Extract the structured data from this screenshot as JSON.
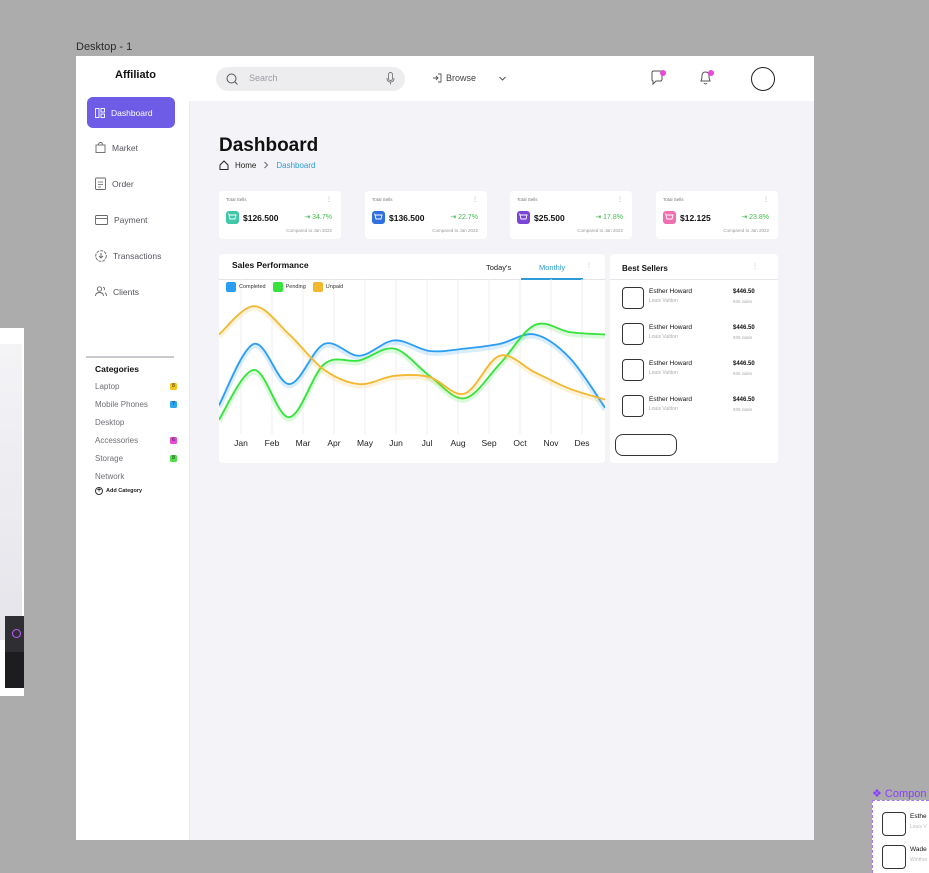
{
  "frame_label": "Desktop - 1",
  "app": {
    "name": "Affiliato"
  },
  "topbar": {
    "search_placeholder": "Search",
    "browse_label": "Browse"
  },
  "sidebar": {
    "items": [
      {
        "label": "Dashboard",
        "icon": "dashboard-icon",
        "active": true
      },
      {
        "label": "Market",
        "icon": "bag-icon"
      },
      {
        "label": "Order",
        "icon": "clipboard-icon"
      },
      {
        "label": "Payment",
        "icon": "card-icon"
      },
      {
        "label": "Transactions",
        "icon": "coin-icon"
      },
      {
        "label": "Clients",
        "icon": "users-icon"
      }
    ],
    "categories_title": "Categories",
    "categories": [
      {
        "label": "Laptop",
        "count": "8",
        "color": "#f5c518"
      },
      {
        "label": "Mobile Phones",
        "count": "7",
        "color": "#2aa7f0"
      },
      {
        "label": "Desktop",
        "count": "",
        "color": ""
      },
      {
        "label": "Accessories",
        "count": "6",
        "color": "#e64ad6"
      },
      {
        "label": "Storage",
        "count": "8",
        "color": "#52e04a"
      },
      {
        "label": "Network",
        "count": "",
        "color": ""
      }
    ],
    "add_category": "Add Category"
  },
  "page": {
    "title": "Dashboard",
    "breadcrumb_home": "Home",
    "breadcrumb_current": "Dashboard"
  },
  "stats": [
    {
      "label": "Total Sells",
      "value": "$126.500",
      "change": "34.7%",
      "compare": "Compared to Jan 2022",
      "icon_color": "#3fc7a8"
    },
    {
      "label": "Total Sells",
      "value": "$136.500",
      "change": "22.7%",
      "compare": "Compared to Jan 2022",
      "icon_color": "#2f6fe0"
    },
    {
      "label": "Total Sells",
      "value": "$25.500",
      "change": "17.8%",
      "compare": "Compared to Jan 2022",
      "icon_color": "#7a45d6"
    },
    {
      "label": "Total Sells",
      "value": "$12.125",
      "change": "23.8%",
      "compare": "Compared to Jan 2022",
      "icon_color": "#ef6fb1"
    }
  ],
  "sales": {
    "title": "Sales Performance",
    "tab_today": "Today's",
    "tab_monthly": "Monthly"
  },
  "best_sellers": {
    "title": "Best Sellers",
    "items": [
      {
        "name": "Esther Howard",
        "brand": "Louis Vuitton",
        "price": "$446.50",
        "sales": "935 sales"
      },
      {
        "name": "Esther Howard",
        "brand": "Louis Vuitton",
        "price": "$446.50",
        "sales": "935 sales"
      },
      {
        "name": "Esther Howard",
        "brand": "Louis Vuitton",
        "price": "$446.50",
        "sales": "935 sales"
      },
      {
        "name": "Esther Howard",
        "brand": "Louis Vuitton",
        "price": "$446.50",
        "sales": "935 sales"
      }
    ]
  },
  "component_panel": {
    "label": "❖ Compon",
    "items": [
      {
        "name": "Esthe",
        "sub": "Louis V"
      },
      {
        "name": "Wade",
        "sub": "Winthro"
      }
    ]
  },
  "chart_data": {
    "type": "line",
    "categories": [
      "Jan",
      "Feb",
      "Mar",
      "Apr",
      "May",
      "Jun",
      "Jul",
      "Aug",
      "Sep",
      "Oct",
      "Nov",
      "Des"
    ],
    "series": [
      {
        "name": "Completed",
        "color": "#2a9df4",
        "values": [
          20,
          72,
          38,
          72,
          62,
          75,
          66,
          68,
          72,
          80,
          60,
          18
        ]
      },
      {
        "name": "Pending",
        "color": "#36e33c",
        "values": [
          8,
          50,
          10,
          55,
          58,
          68,
          45,
          26,
          55,
          88,
          82,
          80
        ]
      },
      {
        "name": "Unpaid",
        "color": "#f2b930",
        "values": [
          80,
          104,
          80,
          50,
          38,
          45,
          44,
          30,
          62,
          48,
          34,
          25
        ]
      }
    ],
    "ylim": [
      0,
      110
    ],
    "grid": true,
    "legend": "top-left"
  }
}
